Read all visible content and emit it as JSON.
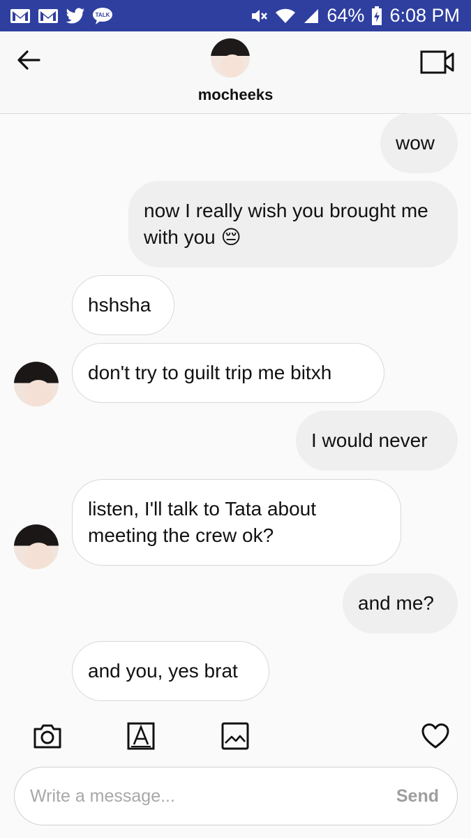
{
  "status_bar": {
    "battery": "64%",
    "time": "6:08 PM",
    "left_icons": [
      "gmail-icon",
      "gmail-icon",
      "twitter-icon",
      "talk-icon"
    ],
    "talk_label": "TALK",
    "right_icons": [
      "mute-icon",
      "wifi-icon",
      "signal-icon",
      "battery-charging-icon"
    ],
    "color": "#2f3f9f"
  },
  "header": {
    "username": "mocheeks",
    "back_icon": "arrow-left-icon",
    "video_icon": "video-camera-icon"
  },
  "messages": [
    {
      "direction": "outgoing",
      "text": "wow"
    },
    {
      "direction": "outgoing",
      "text": "now I really wish you brought me with you 😔"
    },
    {
      "direction": "incoming",
      "text": "hshsha"
    },
    {
      "direction": "incoming",
      "text": "don't try to guilt trip me bitxh"
    },
    {
      "direction": "outgoing",
      "text": "I would never"
    },
    {
      "direction": "incoming",
      "text": "listen, I'll talk to Tata about meeting the crew ok?"
    },
    {
      "direction": "outgoing",
      "text": "and me?"
    },
    {
      "direction": "incoming",
      "text": "and you, yes brat"
    }
  ],
  "toolbar": {
    "icons": [
      "camera-icon",
      "text-style-icon",
      "gallery-icon",
      "heart-icon"
    ]
  },
  "composer": {
    "placeholder": "Write a message...",
    "value": "",
    "send_label": "Send"
  },
  "colors": {
    "outgoing_bubble": "#efefef",
    "incoming_bubble": "#ffffff",
    "background": "#fafafa"
  }
}
